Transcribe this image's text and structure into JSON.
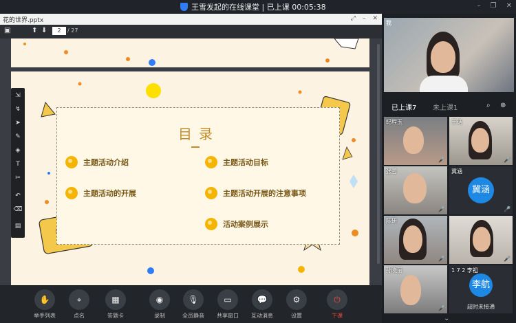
{
  "window": {
    "title": "王雪发起的在线课堂 | 已上课 00:05:38",
    "controls": [
      "–",
      "❐",
      "✕"
    ]
  },
  "document": {
    "filename": "花的世界.pptx",
    "current_page": "2",
    "total_pages": "/ 27"
  },
  "slide": {
    "title": "目录",
    "items": [
      {
        "label": "主题活动介绍"
      },
      {
        "label": "主题活动目标"
      },
      {
        "label": "主题活动的开展"
      },
      {
        "label": "主题活动开展的注意事项"
      },
      {
        "label": "活动案例展示"
      }
    ]
  },
  "bottom_bar": {
    "buttons": [
      {
        "label": "举手列表",
        "icon": "hand-icon"
      },
      {
        "label": "点名",
        "icon": "location-pin-icon"
      },
      {
        "label": "答题卡",
        "icon": "answer-card-icon"
      },
      {
        "label": "录制",
        "icon": "record-icon"
      },
      {
        "label": "全员静音",
        "icon": "mute-all-icon"
      },
      {
        "label": "共享窗口",
        "icon": "share-window-icon"
      },
      {
        "label": "互动消息",
        "icon": "chat-bubble-icon"
      },
      {
        "label": "设置",
        "icon": "gear-icon"
      },
      {
        "label": "下课",
        "icon": "power-icon"
      }
    ]
  },
  "participants": {
    "self_label": "我",
    "tabs": [
      {
        "label": "已上课7"
      },
      {
        "label": "未上课1"
      }
    ],
    "tiles": [
      {
        "name": "纪程玉"
      },
      {
        "name": "王话"
      },
      {
        "name": "张雪"
      },
      {
        "name": "冀涵",
        "avatar_text": "冀涵"
      },
      {
        "name": "陈研"
      },
      {
        "name": ""
      },
      {
        "name": "孙晓丽"
      },
      {
        "name": "1 7 2 李祖",
        "avatar_text": "李航",
        "status": "超时未接通"
      }
    ]
  },
  "colors": {
    "accent_blue": "#1e88e5",
    "end_red": "#e94b3c",
    "slide_gold": "#c28a2a"
  }
}
